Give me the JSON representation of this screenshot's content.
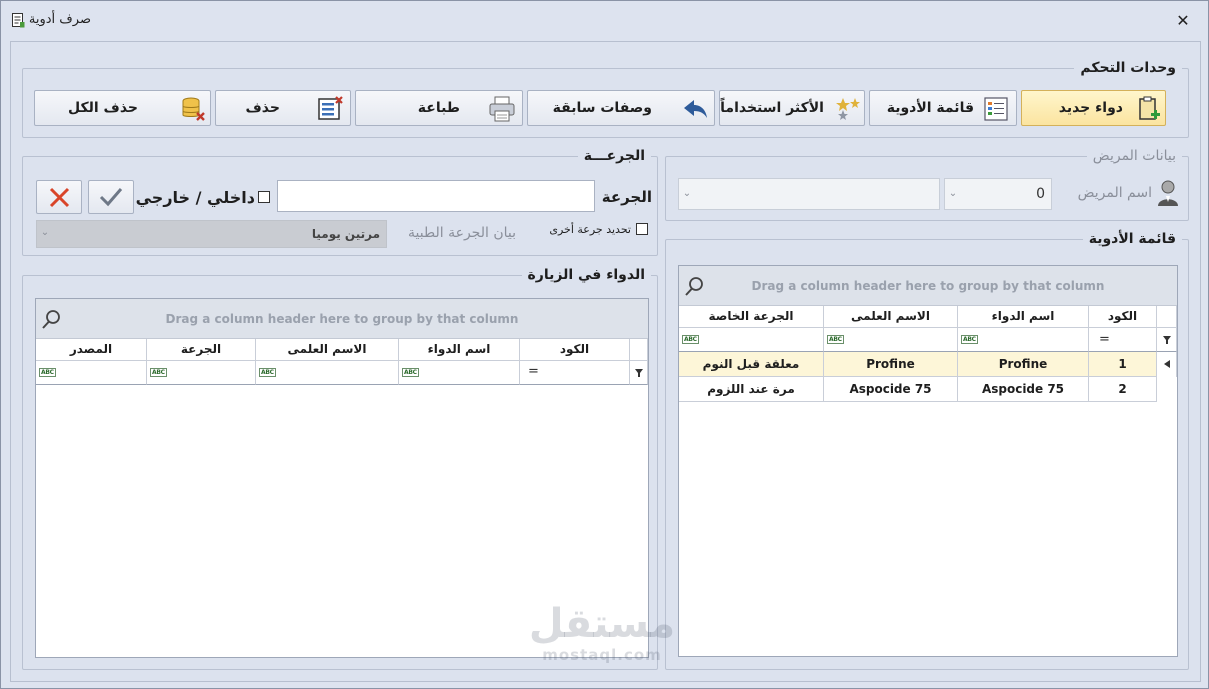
{
  "window": {
    "title": "صرف أدوية",
    "close_glyph": "✕"
  },
  "controls": {
    "title": "وحدات التحكم",
    "buttons": {
      "new_drug": "دواء جديد",
      "drug_list": "قائمة الأدوية",
      "most_used": "الأكثر استخداماً",
      "previous_prescriptions": "وصفات سابقة",
      "print": "طباعة",
      "delete": "حذف",
      "delete_all": "حذف الكل"
    }
  },
  "patient": {
    "title": "بيانات المريض",
    "name_label": "اسم المريض",
    "id_value": "0"
  },
  "dose": {
    "title": "الجرعـــة",
    "dose_label": "الجرعة",
    "inside_outside_label": "داخلي / خارجي",
    "other_dose_label": "تحديد جرعة أخرى",
    "medical_dose_label": "بيان الجرعة الطبية",
    "medical_dose_value": "مرتين يوميا"
  },
  "drug_list": {
    "title": "قائمة الأدوية",
    "group_panel_text": "Drag a column header here to group by that column",
    "columns": [
      "الكود",
      "اسم الدواء",
      "الاسم العلمى",
      "الجرعة الخاصة"
    ],
    "rows": [
      {
        "code": "1",
        "name": "Profine",
        "scientific": "Profine",
        "dose": "معلقة قبل النوم",
        "selected": true
      },
      {
        "code": "2",
        "name": "Aspocide 75",
        "scientific": "Aspocide 75",
        "dose": "مرة عند اللزوم",
        "selected": false
      }
    ]
  },
  "visit_drugs": {
    "title": "الدواء في الزيارة",
    "group_panel_text": "Drag a column header here to group by that column",
    "columns": [
      "الكود",
      "اسم الدواء",
      "الاسم العلمى",
      "الجرعة",
      "المصدر"
    ]
  },
  "filter_glyph": "ABC",
  "equals_glyph": "=",
  "watermark": {
    "arabic": "مستقل",
    "latin": "mostaql.com"
  },
  "colors": {
    "background": "#dde3ef",
    "active_button": "#fbe4a0",
    "selected_row": "#fdf6d8",
    "cancel_red": "#d9452a",
    "ok_gray": "#6e7887"
  }
}
